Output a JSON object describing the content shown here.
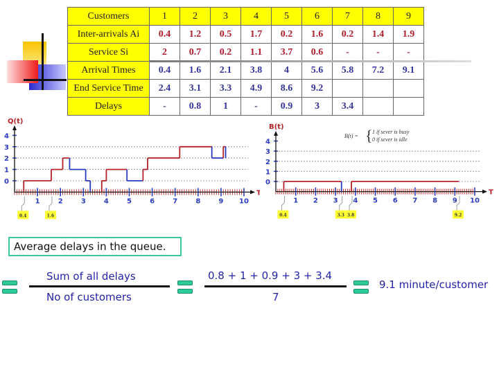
{
  "table": {
    "headers": [
      "Customers",
      "1",
      "2",
      "3",
      "4",
      "5",
      "6",
      "7",
      "8",
      "9"
    ],
    "rows": [
      {
        "label": "Inter-arrivals Ai",
        "color": "red",
        "values": [
          "0.4",
          "1.2",
          "0.5",
          "1.7",
          "0.2",
          "1.6",
          "0.2",
          "1.4",
          "1.9"
        ]
      },
      {
        "label": "Service Si",
        "color": "red",
        "values": [
          "2",
          "0.7",
          "0.2",
          "1.1",
          "3.7",
          "0.6",
          "-",
          "-",
          "-"
        ]
      },
      {
        "label": "Arrival Times",
        "color": "blue",
        "values": [
          "0.4",
          "1.6",
          "2.1",
          "3.8",
          "4",
          "5.6",
          "5.8",
          "7.2",
          "9.1"
        ]
      },
      {
        "label": "End Service Time",
        "color": "blue",
        "values": [
          "2.4",
          "3.1",
          "3.3",
          "4.9",
          "8.6",
          "9.2",
          "",
          "",
          ""
        ]
      },
      {
        "label": "Delays",
        "color": "blue",
        "values": [
          "-",
          "0.8",
          "1",
          "-",
          "0.9",
          "3",
          "3.4",
          "",
          ""
        ]
      }
    ]
  },
  "chart_data": [
    {
      "type": "line",
      "ylabel": "Q(t)",
      "xlabel": "T",
      "xticks": [
        "1",
        "2",
        "3",
        "4",
        "5",
        "6",
        "7",
        "8",
        "9",
        "10"
      ],
      "yticks": [
        "0",
        "1",
        "2",
        "3",
        "4"
      ],
      "xlim": [
        0,
        10
      ],
      "grid": true,
      "baseline_level": -1,
      "segments": [
        {
          "t0": 0.4,
          "t1": 1.6,
          "q": 0,
          "color": "#b52228"
        },
        {
          "t0": 1.6,
          "t1": 2.1,
          "q": 1,
          "color": "#b52228"
        },
        {
          "t0": 2.1,
          "t1": 2.4,
          "q": 2,
          "color": "#b52228"
        },
        {
          "t0": 2.4,
          "t1": 3.1,
          "q": 1,
          "color": "#2a3ac0"
        },
        {
          "t0": 3.1,
          "t1": 3.3,
          "q": 0,
          "color": "#2a3ac0"
        },
        {
          "t0": 3.3,
          "t1": 3.3,
          "q": -1,
          "color": "#2a3ac0"
        },
        {
          "t0": 3.8,
          "t1": 4.0,
          "q": 0,
          "color": "#b52228"
        },
        {
          "t0": 4.0,
          "t1": 4.9,
          "q": 1,
          "color": "#b52228"
        },
        {
          "t0": 4.9,
          "t1": 5.6,
          "q": 0,
          "color": "#2a3ac0"
        },
        {
          "t0": 5.6,
          "t1": 5.8,
          "q": 1,
          "color": "#b52228"
        },
        {
          "t0": 5.8,
          "t1": 7.2,
          "q": 2,
          "color": "#b52228"
        },
        {
          "t0": 7.2,
          "t1": 8.6,
          "q": 3,
          "color": "#b52228"
        },
        {
          "t0": 8.6,
          "t1": 9.1,
          "q": 2,
          "color": "#2a3ac0"
        },
        {
          "t0": 9.1,
          "t1": 9.2,
          "q": 3,
          "color": "#b52228"
        },
        {
          "t0": 9.2,
          "t1": 9.2,
          "q": 2,
          "color": "#2a3ac0"
        }
      ],
      "markers": [
        "0.4",
        "1.6"
      ]
    },
    {
      "type": "line",
      "ylabel": "B(t)",
      "xlabel": "T",
      "xticks": [
        "1",
        "2",
        "3",
        "4",
        "5",
        "6",
        "7",
        "8",
        "9",
        "10"
      ],
      "yticks": [
        "0",
        "1",
        "2",
        "3",
        "4"
      ],
      "xlim": [
        0,
        10
      ],
      "grid": true,
      "baseline_level": -1,
      "formula": {
        "lhs": "B(t) =",
        "case1": "1   if sever is busy",
        "case2": "0   if sever is idle"
      },
      "segments": [
        {
          "t0": 0.4,
          "t1": 3.3,
          "q": 0,
          "color": "#b52228"
        },
        {
          "t0": 3.3,
          "t1": 3.3,
          "q": -1,
          "color": "#2a3ac0"
        },
        {
          "t0": 3.8,
          "t1": 9.2,
          "q": 0,
          "color": "#b52228"
        }
      ],
      "markers": [
        "0.4",
        "3.3",
        "3.8",
        "9.2"
      ]
    }
  ],
  "summary": {
    "box_label": "Average delays in the queue.",
    "numerator_text": "Sum of all delays",
    "denominator_text": "No of customers",
    "numerator_values": "0.8 + 1 + 0.9 + 3 + 3.4",
    "denominator_value": "7",
    "result": "9.1 minute/customer"
  }
}
